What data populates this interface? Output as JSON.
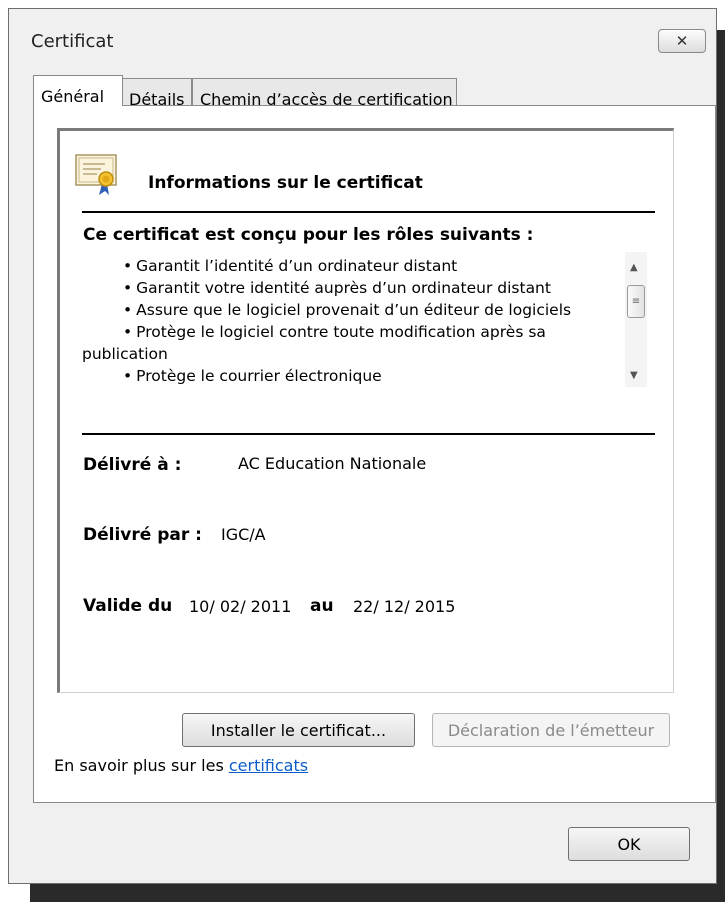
{
  "window": {
    "title": "Certificat",
    "close_glyph": "✕",
    "close_icon": "close-icon"
  },
  "tabs": [
    {
      "label": "Général",
      "active": true
    },
    {
      "label": "Détails",
      "active": false
    },
    {
      "label": "Chemin d’accès de certification",
      "active": false
    }
  ],
  "info": {
    "icon": "certificate-icon",
    "title": "Informations sur le certificat",
    "purposes_heading": "Ce certificat est conçu pour les rôles suivants :",
    "purposes": [
      "Garantit l’identité d’un ordinateur distant",
      "Garantit votre identité auprès d’un ordinateur distant",
      "Assure que le logiciel provenait d’un éditeur de logiciels",
      "Protège le logiciel contre toute modification après sa publication",
      "Protège le courrier électronique"
    ],
    "issued_to_label": "Délivré à :",
    "issued_to_value": "AC Education Nationale",
    "issued_by_label": "Délivré par :",
    "issued_by_value": "IGC/A",
    "valid_from_label": "Valide du",
    "valid_from_value": "10/ 02/ 2011",
    "valid_to_label": "au",
    "valid_to_value": "22/ 12/ 2015"
  },
  "buttons": {
    "install": "Installer le certificat...",
    "issuer_statement": "Déclaration de l’émetteur",
    "ok": "OK"
  },
  "learn_more": {
    "prefix": "En savoir plus sur les ",
    "link": "certificats"
  },
  "colors": {
    "link": "#0b5ec9",
    "disabled_text": "#8a8a8a"
  }
}
